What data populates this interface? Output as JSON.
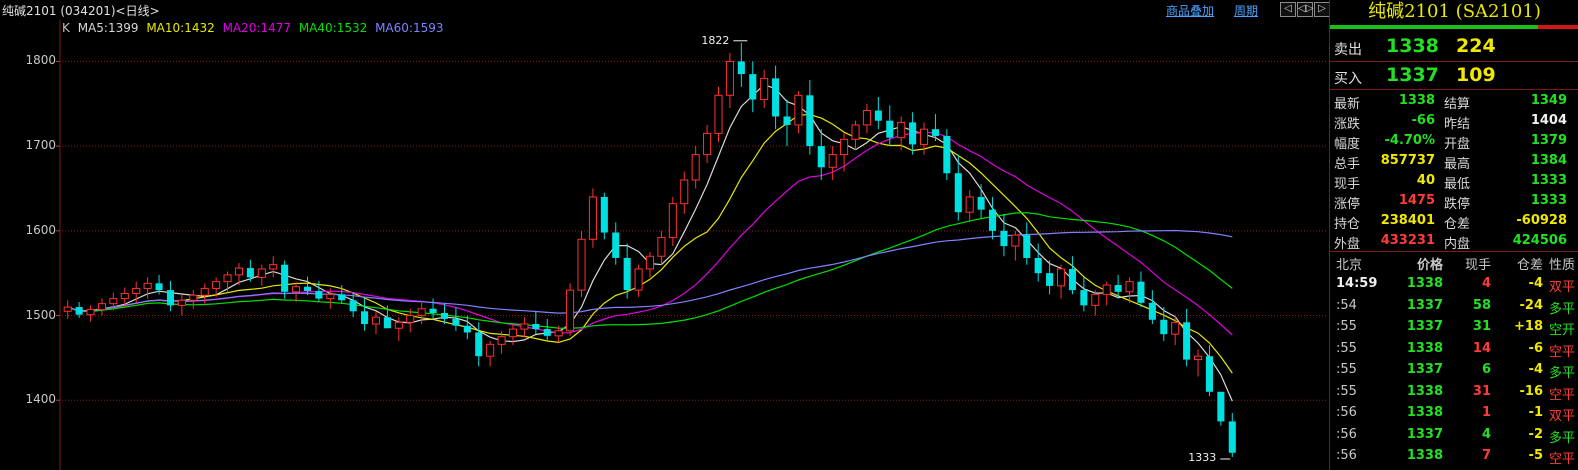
{
  "header": {
    "instrument": "纯碱2101 (034201)<日线>",
    "link_overlay": "商品叠加",
    "link_period": "周期",
    "btn_icons": [
      "arrow-left-icon",
      "arrows-both-icon",
      "arrow-right-icon"
    ],
    "btn_glyphs": [
      "◁",
      "◁▷",
      "▷"
    ]
  },
  "ma_legend": [
    {
      "label": "K",
      "color": "#c0c0c0"
    },
    {
      "label": "MA5:1399",
      "color": "#d8d8d8"
    },
    {
      "label": "MA10:1432",
      "color": "#e8e800"
    },
    {
      "label": "MA20:1477",
      "color": "#e000e0"
    },
    {
      "label": "MA40:1532",
      "color": "#00e000"
    },
    {
      "label": "MA60:1593",
      "color": "#8080ff"
    }
  ],
  "chart_data": {
    "type": "candlestick",
    "title": "纯碱2101 (034201)<日线>",
    "y_ticks": [
      1400,
      1500,
      1600,
      1700,
      1800
    ],
    "ylim": [
      1320,
      1830
    ],
    "high_marker": {
      "value": 1822,
      "label": "1822"
    },
    "low_marker": {
      "value": 1333,
      "label": "1333"
    },
    "up_color": "#ff3030",
    "down_color": "#00e0e0",
    "grid": "horizontal dotted",
    "series": [
      {
        "name": "MA5",
        "color": "#d8d8d8",
        "last": 1399
      },
      {
        "name": "MA10",
        "color": "#e8e800",
        "last": 1432
      },
      {
        "name": "MA20",
        "color": "#e000e0",
        "last": 1477
      },
      {
        "name": "MA40",
        "color": "#00e000",
        "last": 1532
      },
      {
        "name": "MA60",
        "color": "#8080ff",
        "last": 1593
      }
    ],
    "candles": [
      [
        1505,
        1518,
        1496,
        1510
      ],
      [
        1510,
        1516,
        1497,
        1501
      ],
      [
        1501,
        1512,
        1493,
        1507
      ],
      [
        1507,
        1520,
        1500,
        1514
      ],
      [
        1514,
        1527,
        1506,
        1520
      ],
      [
        1520,
        1533,
        1510,
        1526
      ],
      [
        1526,
        1540,
        1515,
        1532
      ],
      [
        1532,
        1545,
        1520,
        1538
      ],
      [
        1538,
        1548,
        1525,
        1530
      ],
      [
        1530,
        1541,
        1505,
        1512
      ],
      [
        1512,
        1525,
        1500,
        1518
      ],
      [
        1518,
        1530,
        1508,
        1524
      ],
      [
        1524,
        1538,
        1514,
        1532
      ],
      [
        1532,
        1545,
        1522,
        1540
      ],
      [
        1540,
        1552,
        1528,
        1548
      ],
      [
        1548,
        1562,
        1536,
        1556
      ],
      [
        1556,
        1566,
        1540,
        1545
      ],
      [
        1545,
        1560,
        1535,
        1555
      ],
      [
        1555,
        1570,
        1545,
        1560
      ],
      [
        1560,
        1565,
        1520,
        1528
      ],
      [
        1528,
        1540,
        1516,
        1534
      ],
      [
        1534,
        1546,
        1524,
        1529
      ],
      [
        1529,
        1541,
        1516,
        1520
      ],
      [
        1520,
        1532,
        1508,
        1525
      ],
      [
        1525,
        1536,
        1514,
        1518
      ],
      [
        1518,
        1528,
        1498,
        1505
      ],
      [
        1505,
        1520,
        1482,
        1490
      ],
      [
        1490,
        1505,
        1478,
        1498
      ],
      [
        1498,
        1512,
        1488,
        1485
      ],
      [
        1485,
        1498,
        1470,
        1492
      ],
      [
        1492,
        1508,
        1480,
        1500
      ],
      [
        1500,
        1515,
        1490,
        1508
      ],
      [
        1508,
        1520,
        1496,
        1503
      ],
      [
        1503,
        1514,
        1490,
        1496
      ],
      [
        1496,
        1510,
        1482,
        1488
      ],
      [
        1488,
        1500,
        1472,
        1480
      ],
      [
        1480,
        1492,
        1440,
        1452
      ],
      [
        1452,
        1470,
        1440,
        1466
      ],
      [
        1466,
        1482,
        1455,
        1475
      ],
      [
        1475,
        1490,
        1465,
        1484
      ],
      [
        1484,
        1498,
        1474,
        1490
      ],
      [
        1490,
        1505,
        1478,
        1484
      ],
      [
        1484,
        1496,
        1470,
        1476
      ],
      [
        1476,
        1488,
        1468,
        1482
      ],
      [
        1482,
        1538,
        1476,
        1530
      ],
      [
        1530,
        1600,
        1522,
        1590
      ],
      [
        1590,
        1650,
        1580,
        1640
      ],
      [
        1640,
        1645,
        1590,
        1598
      ],
      [
        1598,
        1610,
        1560,
        1568
      ],
      [
        1568,
        1585,
        1520,
        1530
      ],
      [
        1530,
        1560,
        1522,
        1555
      ],
      [
        1555,
        1575,
        1545,
        1570
      ],
      [
        1570,
        1600,
        1560,
        1592
      ],
      [
        1592,
        1640,
        1582,
        1632
      ],
      [
        1632,
        1670,
        1620,
        1660
      ],
      [
        1660,
        1700,
        1650,
        1690
      ],
      [
        1690,
        1725,
        1680,
        1715
      ],
      [
        1715,
        1770,
        1705,
        1760
      ],
      [
        1760,
        1810,
        1745,
        1800
      ],
      [
        1800,
        1822,
        1770,
        1785
      ],
      [
        1785,
        1800,
        1740,
        1755
      ],
      [
        1755,
        1790,
        1745,
        1780
      ],
      [
        1780,
        1795,
        1720,
        1735
      ],
      [
        1735,
        1755,
        1700,
        1725
      ],
      [
        1725,
        1765,
        1715,
        1760
      ],
      [
        1760,
        1778,
        1690,
        1700
      ],
      [
        1700,
        1720,
        1660,
        1675
      ],
      [
        1675,
        1700,
        1660,
        1690
      ],
      [
        1690,
        1715,
        1670,
        1708
      ],
      [
        1708,
        1730,
        1695,
        1725
      ],
      [
        1725,
        1750,
        1715,
        1742
      ],
      [
        1742,
        1758,
        1720,
        1730
      ],
      [
        1730,
        1748,
        1700,
        1710
      ],
      [
        1710,
        1735,
        1695,
        1728
      ],
      [
        1728,
        1740,
        1690,
        1702
      ],
      [
        1702,
        1728,
        1690,
        1720
      ],
      [
        1720,
        1738,
        1706,
        1712
      ],
      [
        1712,
        1720,
        1660,
        1668
      ],
      [
        1668,
        1690,
        1612,
        1622
      ],
      [
        1622,
        1648,
        1610,
        1640
      ],
      [
        1640,
        1655,
        1615,
        1625
      ],
      [
        1625,
        1640,
        1590,
        1600
      ],
      [
        1600,
        1620,
        1570,
        1582
      ],
      [
        1582,
        1600,
        1565,
        1595
      ],
      [
        1595,
        1610,
        1560,
        1568
      ],
      [
        1568,
        1585,
        1540,
        1550
      ],
      [
        1550,
        1565,
        1525,
        1535
      ],
      [
        1535,
        1560,
        1520,
        1555
      ],
      [
        1555,
        1570,
        1525,
        1530
      ],
      [
        1530,
        1545,
        1505,
        1512
      ],
      [
        1512,
        1530,
        1500,
        1525
      ],
      [
        1525,
        1540,
        1512,
        1536
      ],
      [
        1536,
        1548,
        1520,
        1528
      ],
      [
        1528,
        1545,
        1515,
        1540
      ],
      [
        1540,
        1552,
        1510,
        1515
      ],
      [
        1515,
        1530,
        1490,
        1495
      ],
      [
        1495,
        1510,
        1470,
        1478
      ],
      [
        1478,
        1500,
        1465,
        1492
      ],
      [
        1492,
        1508,
        1440,
        1448
      ],
      [
        1448,
        1460,
        1428,
        1452
      ],
      [
        1452,
        1465,
        1405,
        1410
      ],
      [
        1410,
        1400,
        1370,
        1375
      ],
      [
        1375,
        1385,
        1333,
        1338
      ]
    ]
  },
  "quote": {
    "title": "纯碱2101 (SA2101)",
    "strip_colors": [
      "#18c018",
      "#d01818"
    ],
    "ask": {
      "label": "卖出",
      "price": "1338",
      "volume": "224"
    },
    "bid": {
      "label": "买入",
      "price": "1337",
      "volume": "109"
    },
    "stats": [
      {
        "l1": "最新",
        "v1": "1338",
        "c1": "c-green",
        "l2": "结算",
        "v2": "1349",
        "c2": "c-green"
      },
      {
        "l1": "涨跌",
        "v1": "-66",
        "c1": "c-green",
        "l2": "昨结",
        "v2": "1404",
        "c2": "c-white"
      },
      {
        "l1": "幅度",
        "v1": "-4.70%",
        "c1": "c-green",
        "l2": "开盘",
        "v2": "1379",
        "c2": "c-green"
      },
      {
        "l1": "总手",
        "v1": "857737",
        "c1": "c-yellow",
        "l2": "最高",
        "v2": "1384",
        "c2": "c-green"
      },
      {
        "l1": "现手",
        "v1": "40",
        "c1": "c-yellow",
        "l2": "最低",
        "v2": "1333",
        "c2": "c-green"
      },
      {
        "l1": "涨停",
        "v1": "1475",
        "c1": "c-red",
        "l2": "跌停",
        "v2": "1333",
        "c2": "c-green"
      },
      {
        "l1": "持仓",
        "v1": "238401",
        "c1": "c-yellow",
        "l2": "仓差",
        "v2": "-60928",
        "c2": "c-yellow"
      },
      {
        "l1": "外盘",
        "v1": "433231",
        "c1": "c-red",
        "l2": "内盘",
        "v2": "424506",
        "c2": "c-green"
      }
    ],
    "ticks_header": {
      "time": "北京",
      "price": "价格",
      "vol": "现手",
      "oi": "仓差",
      "nature": "性质"
    },
    "ticks": [
      {
        "time": "14:59",
        "price": "1338",
        "pc": "c-green",
        "vol": "4",
        "vc": "c-red",
        "oi": "-4",
        "oc": "c-yellow",
        "nature": "双平",
        "nc": "c-red"
      },
      {
        "time": ":54",
        "price": "1337",
        "pc": "c-green",
        "vol": "58",
        "vc": "c-green",
        "oi": "-24",
        "oc": "c-yellow",
        "nature": "多平",
        "nc": "c-green"
      },
      {
        "time": ":55",
        "price": "1337",
        "pc": "c-green",
        "vol": "31",
        "vc": "c-green",
        "oi": "+18",
        "oc": "c-yellow",
        "nature": "空开",
        "nc": "c-green"
      },
      {
        "time": ":55",
        "price": "1338",
        "pc": "c-green",
        "vol": "14",
        "vc": "c-red",
        "oi": "-6",
        "oc": "c-yellow",
        "nature": "空平",
        "nc": "c-red"
      },
      {
        "time": ":55",
        "price": "1337",
        "pc": "c-green",
        "vol": "6",
        "vc": "c-green",
        "oi": "-4",
        "oc": "c-yellow",
        "nature": "多平",
        "nc": "c-green"
      },
      {
        "time": ":55",
        "price": "1338",
        "pc": "c-green",
        "vol": "31",
        "vc": "c-red",
        "oi": "-16",
        "oc": "c-yellow",
        "nature": "空平",
        "nc": "c-red"
      },
      {
        "time": ":56",
        "price": "1338",
        "pc": "c-green",
        "vol": "1",
        "vc": "c-red",
        "oi": "-1",
        "oc": "c-yellow",
        "nature": "双平",
        "nc": "c-red"
      },
      {
        "time": ":56",
        "price": "1337",
        "pc": "c-green",
        "vol": "4",
        "vc": "c-green",
        "oi": "-2",
        "oc": "c-yellow",
        "nature": "多平",
        "nc": "c-green"
      },
      {
        "time": ":56",
        "price": "1338",
        "pc": "c-green",
        "vol": "7",
        "vc": "c-red",
        "oi": "-5",
        "oc": "c-yellow",
        "nature": "空平",
        "nc": "c-red"
      }
    ]
  }
}
